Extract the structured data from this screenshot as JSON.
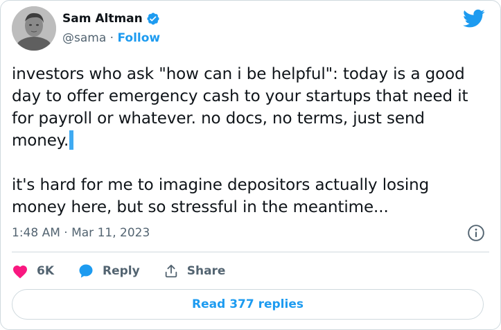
{
  "author": {
    "name": "Sam Altman",
    "handle": "@sama",
    "separator": "·",
    "follow_label": "Follow",
    "verified": true
  },
  "tweet": {
    "paragraph_1": "investors who ask \"how can i be helpful\": today is a good day to offer emergency cash to your startups that need it for payroll or whatever. no docs, no terms, just send money.",
    "paragraph_2": "it's hard for me to imagine depositors actually losing money here, but so stressful in the meantime...",
    "timestamp": "1:48 AM · Mar 11, 2023"
  },
  "actions": {
    "like_count": "6K",
    "reply_label": "Reply",
    "share_label": "Share"
  },
  "read_replies_label": "Read 377 replies",
  "icons": {
    "logo": "twitter-bird-icon",
    "verified": "verified-badge-icon",
    "info": "info-icon",
    "like": "heart-icon",
    "reply": "speech-bubble-icon",
    "share": "share-upload-icon"
  },
  "colors": {
    "accent": "#1d9bf0",
    "like": "#f91880",
    "text": "#0f1419",
    "secondary_text": "#536471",
    "border": "#cfd9de"
  }
}
